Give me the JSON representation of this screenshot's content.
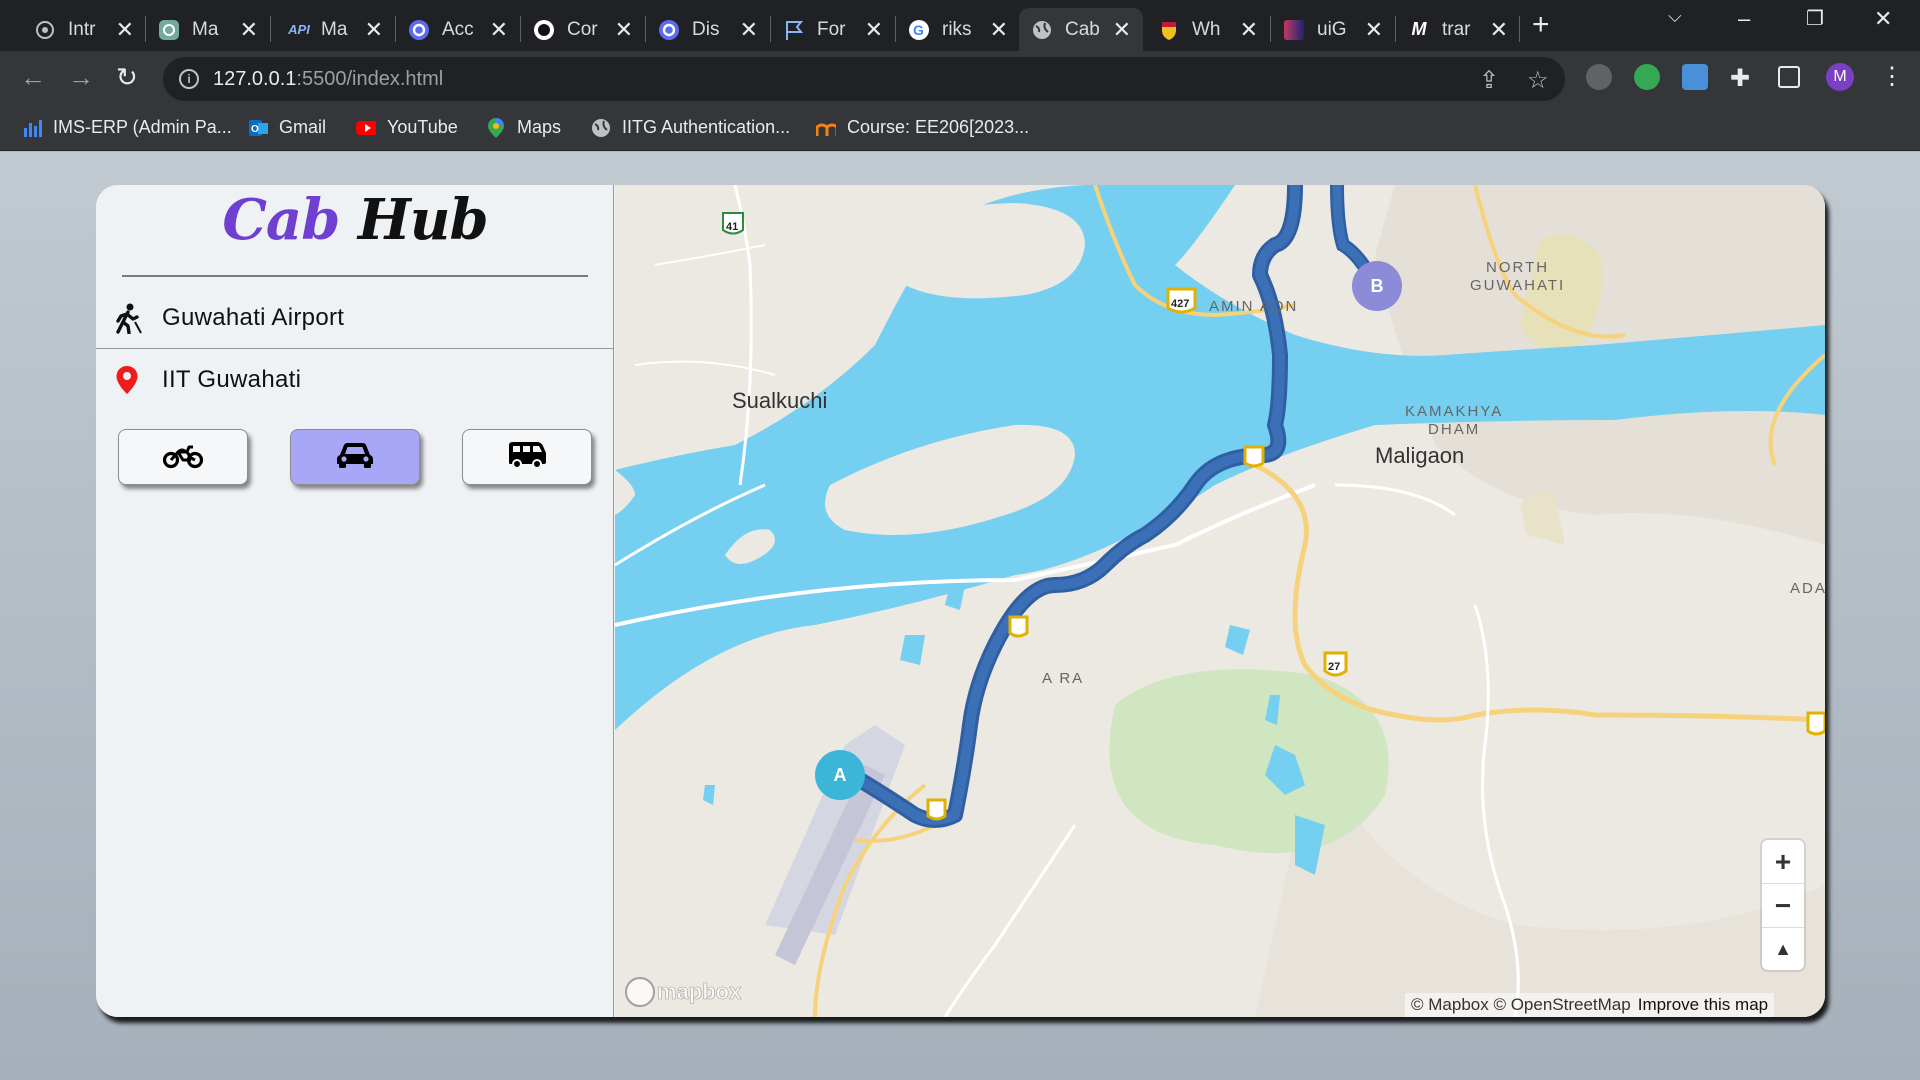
{
  "browser": {
    "tabs": [
      {
        "label": "Intr",
        "icon": "openai-icon"
      },
      {
        "label": "Ma",
        "icon": "chatgpt-icon"
      },
      {
        "label": "Ma",
        "icon": "api-icon"
      },
      {
        "label": "Acc",
        "icon": "circle-app-icon"
      },
      {
        "label": "Cor",
        "icon": "circle-app-icon"
      },
      {
        "label": "Dis",
        "icon": "circle-app-icon"
      },
      {
        "label": "For",
        "icon": "flag-icon"
      },
      {
        "label": "riks",
        "icon": "google-icon"
      },
      {
        "label": "Cab",
        "icon": "globe-icon",
        "active": true
      },
      {
        "label": "Wh",
        "icon": "shield-icon"
      },
      {
        "label": "uiG",
        "icon": "gradient-icon"
      },
      {
        "label": "trar",
        "icon": "m-icon"
      }
    ],
    "api_badge": "API",
    "url_host": "127.0.0.1",
    "url_rest": ":5500/index.html",
    "profile_initial": "M",
    "bookmarks": [
      {
        "label": "IMS-ERP (Admin Pa...",
        "icon": "bar-chart-icon"
      },
      {
        "label": "Gmail",
        "icon": "outlook-icon"
      },
      {
        "label": "YouTube",
        "icon": "youtube-icon"
      },
      {
        "label": "Maps",
        "icon": "maps-pin-icon"
      },
      {
        "label": "IITG Authentication...",
        "icon": "globe-icon"
      },
      {
        "label": "Course: EE206[2023...",
        "icon": "moodle-icon"
      }
    ]
  },
  "app": {
    "logo_part1": "Cab",
    "logo_part2": "Hub",
    "pickup": "Guwahati Airport",
    "destination": "IIT Guwahati",
    "vehicles": [
      {
        "name": "bike",
        "selected": false
      },
      {
        "name": "car",
        "selected": true
      },
      {
        "name": "van",
        "selected": false
      }
    ],
    "colors": {
      "accent": "#6f3fd1",
      "selected": "#a8a6f7",
      "route": "#3b6fb6",
      "water": "#75cff0"
    }
  },
  "map": {
    "labels": {
      "sualkuchi": "Sualkuchi",
      "maligaon": "Maligaon",
      "aminiaon": "AMIN  AON",
      "north": "NORTH",
      "guwahati": "GUWAHATI",
      "kamakhya": "KAMAKHYA",
      "dham": "DHAM",
      "azara": "A  RA",
      "adac": "ADAC"
    },
    "shields": [
      "41",
      "427",
      "27"
    ],
    "marker_a": "A",
    "marker_b": "B",
    "zoom_in": "+",
    "zoom_out": "−",
    "compass": "▲",
    "brand": "mapbox",
    "attribution": "© Mapbox © OpenStreetMap",
    "improve_link": "Improve this map"
  }
}
